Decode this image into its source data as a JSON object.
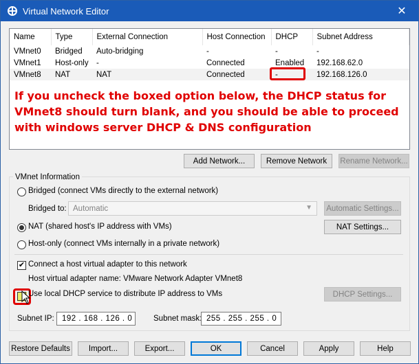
{
  "window": {
    "title": "Virtual Network Editor",
    "close_glyph": "✕"
  },
  "grid": {
    "headers": [
      "Name",
      "Type",
      "External Connection",
      "Host Connection",
      "DHCP",
      "Subnet Address"
    ],
    "rows": [
      [
        "VMnet0",
        "Bridged",
        "Auto-bridging",
        "-",
        "-",
        "-"
      ],
      [
        "VMnet1",
        "Host-only",
        "-",
        "Connected",
        "Enabled",
        "192.168.62.0"
      ],
      [
        "VMnet8",
        "NAT",
        "NAT",
        "Connected",
        "-",
        "192.168.126.0"
      ]
    ],
    "selected_row": 2
  },
  "annotation": {
    "text": "If you uncheck the boxed option below, the DHCP status for VMnet8 should turn blank, and you should be able to proceed with windows server DHCP & DNS configuration",
    "color": "#e00000"
  },
  "network_buttons": {
    "add": "Add Network...",
    "remove": "Remove Network",
    "rename": "Rename Network..."
  },
  "vmnet_info": {
    "legend": "VMnet Information",
    "bridged_label": "Bridged (connect VMs directly to the external network)",
    "bridged_to_label": "Bridged to:",
    "bridged_to_value": "Automatic",
    "auto_settings": "Automatic Settings...",
    "nat_label": "NAT (shared host's IP address with VMs)",
    "nat_settings": "NAT Settings...",
    "hostonly_label": "Host-only (connect VMs internally in a private network)",
    "connect_adapter_label": "Connect a host virtual adapter to this network",
    "adapter_name_label": "Host virtual adapter name: VMware Network Adapter VMnet8",
    "dhcp_label": "Use local DHCP service to distribute IP address to VMs",
    "dhcp_settings": "DHCP Settings...",
    "subnet_ip_label": "Subnet IP:",
    "subnet_ip_value": "192 . 168 . 126 .  0",
    "subnet_mask_label": "Subnet mask:",
    "subnet_mask_value": "255 . 255 . 255 .  0"
  },
  "footer": {
    "restore": "Restore Defaults",
    "import": "Import...",
    "export": "Export...",
    "ok": "OK",
    "cancel": "Cancel",
    "apply": "Apply",
    "help": "Help"
  },
  "colors": {
    "title_bar": "#1a5bb8",
    "annotation_red": "#e00000",
    "focus_blue": "#0078d7"
  }
}
